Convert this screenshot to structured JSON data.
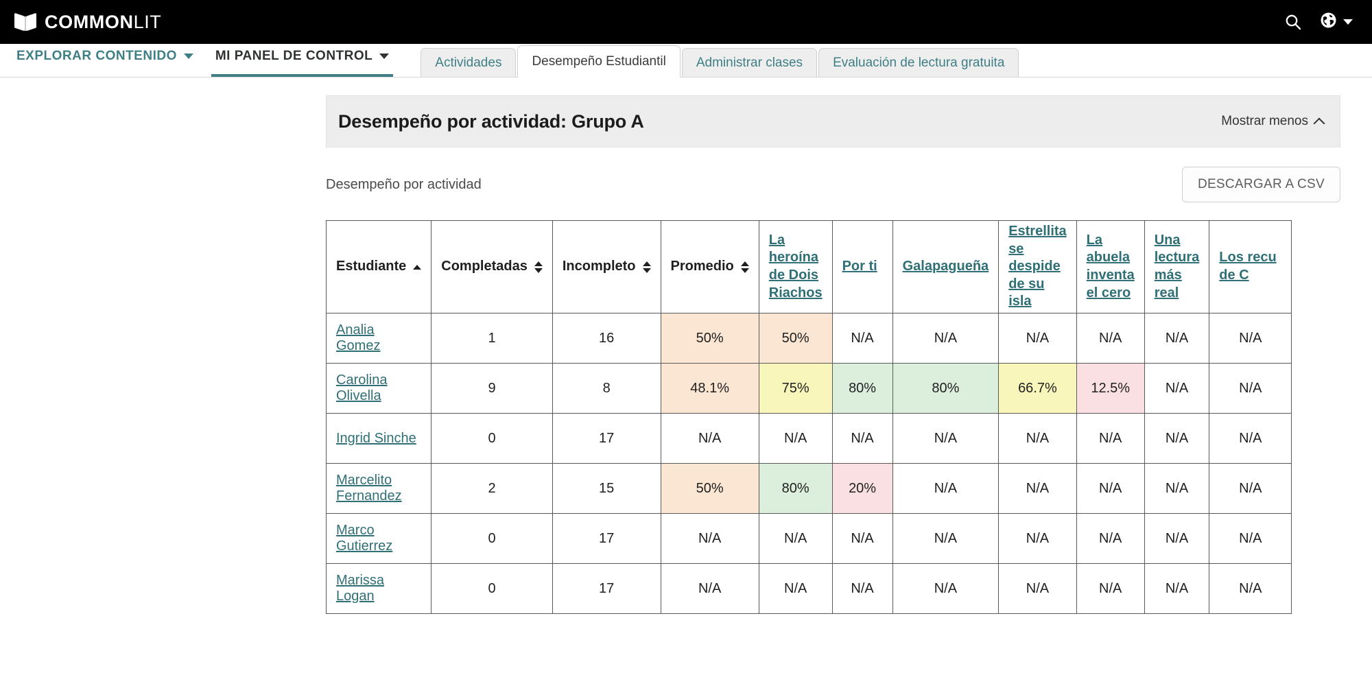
{
  "brand": {
    "name_bold": "COMMON",
    "name_light": "LIT",
    "logo_icon": "open-book-icon"
  },
  "topbar": {
    "search_icon": "search-icon",
    "language_icon": "globe-icon",
    "language_caret": "chevron-down-icon"
  },
  "nav": {
    "primary": [
      {
        "label": "EXPLORAR CONTENIDO",
        "active": false
      },
      {
        "label": "MI PANEL DE CONTROL",
        "active": true
      }
    ],
    "tabs": [
      {
        "label": "Actividades",
        "active": false
      },
      {
        "label": "Desempeño Estudiantil",
        "active": true
      },
      {
        "label": "Administrar clases",
        "active": false
      },
      {
        "label": "Evaluación de lectura gratuita",
        "active": false
      }
    ]
  },
  "panel": {
    "title": "Desempeño por actividad: Grupo A",
    "toggle_label": "Mostrar menos",
    "toggle_icon": "chevron-up-icon",
    "subtitle": "Desempeño por actividad",
    "download_button": "DESCARGAR A CSV"
  },
  "colors": {
    "brand_teal": "#3e7f85",
    "link_teal": "#2f6f76",
    "cell_orange": "#fae6d2",
    "cell_yellow": "#f8f6bb",
    "cell_green": "#dcefdc",
    "cell_pink": "#fadfe3",
    "topbar_black": "#000000",
    "panel_header_gray": "#ededed"
  },
  "table": {
    "headers": [
      {
        "label": "Estudiante",
        "sort": "asc",
        "link": false
      },
      {
        "label": "Completadas",
        "sort": "both",
        "link": false
      },
      {
        "label": "Incompleto",
        "sort": "both",
        "link": false
      },
      {
        "label": "Promedio",
        "sort": "both",
        "link": false
      },
      {
        "label": "La heroína de Dois Riachos",
        "sort": "none",
        "link": true
      },
      {
        "label": "Por ti",
        "sort": "none",
        "link": true
      },
      {
        "label": "Galapagueña",
        "sort": "none",
        "link": true
      },
      {
        "label": "Estrellita se despide de su isla",
        "sort": "none",
        "link": true
      },
      {
        "label": "La abuela inventa el cero",
        "sort": "none",
        "link": true
      },
      {
        "label": "Una lectura más real",
        "sort": "none",
        "link": true
      },
      {
        "label": "Los recu de C",
        "sort": "none",
        "link": true,
        "truncated": true
      }
    ],
    "rows": [
      {
        "student": "Analia Gomez",
        "completadas": "1",
        "incompleto": "16",
        "promedio": {
          "value": "50%",
          "color": "orange"
        },
        "activities": [
          {
            "value": "50%",
            "color": "orange"
          },
          {
            "value": "N/A",
            "color": "none"
          },
          {
            "value": "N/A",
            "color": "none"
          },
          {
            "value": "N/A",
            "color": "none"
          },
          {
            "value": "N/A",
            "color": "none"
          },
          {
            "value": "N/A",
            "color": "none"
          },
          {
            "value": "N/A",
            "color": "none"
          }
        ]
      },
      {
        "student": "Carolina Olivella",
        "completadas": "9",
        "incompleto": "8",
        "promedio": {
          "value": "48.1%",
          "color": "orange"
        },
        "activities": [
          {
            "value": "75%",
            "color": "yellow"
          },
          {
            "value": "80%",
            "color": "green"
          },
          {
            "value": "80%",
            "color": "green"
          },
          {
            "value": "66.7%",
            "color": "yellow"
          },
          {
            "value": "12.5%",
            "color": "pink"
          },
          {
            "value": "N/A",
            "color": "none"
          },
          {
            "value": "N/A",
            "color": "none"
          }
        ]
      },
      {
        "student": "Ingrid Sinche",
        "completadas": "0",
        "incompleto": "17",
        "promedio": {
          "value": "N/A",
          "color": "none"
        },
        "activities": [
          {
            "value": "N/A",
            "color": "none"
          },
          {
            "value": "N/A",
            "color": "none"
          },
          {
            "value": "N/A",
            "color": "none"
          },
          {
            "value": "N/A",
            "color": "none"
          },
          {
            "value": "N/A",
            "color": "none"
          },
          {
            "value": "N/A",
            "color": "none"
          },
          {
            "value": "N/A",
            "color": "none"
          }
        ]
      },
      {
        "student": "Marcelito Fernandez",
        "completadas": "2",
        "incompleto": "15",
        "promedio": {
          "value": "50%",
          "color": "orange"
        },
        "activities": [
          {
            "value": "80%",
            "color": "green"
          },
          {
            "value": "20%",
            "color": "pink"
          },
          {
            "value": "N/A",
            "color": "none"
          },
          {
            "value": "N/A",
            "color": "none"
          },
          {
            "value": "N/A",
            "color": "none"
          },
          {
            "value": "N/A",
            "color": "none"
          },
          {
            "value": "N/A",
            "color": "none"
          }
        ]
      },
      {
        "student": "Marco Gutierrez",
        "completadas": "0",
        "incompleto": "17",
        "promedio": {
          "value": "N/A",
          "color": "none"
        },
        "activities": [
          {
            "value": "N/A",
            "color": "none"
          },
          {
            "value": "N/A",
            "color": "none"
          },
          {
            "value": "N/A",
            "color": "none"
          },
          {
            "value": "N/A",
            "color": "none"
          },
          {
            "value": "N/A",
            "color": "none"
          },
          {
            "value": "N/A",
            "color": "none"
          },
          {
            "value": "N/A",
            "color": "none"
          }
        ]
      },
      {
        "student": "Marissa Logan",
        "completadas": "0",
        "incompleto": "17",
        "promedio": {
          "value": "N/A",
          "color": "none"
        },
        "activities": [
          {
            "value": "N/A",
            "color": "none"
          },
          {
            "value": "N/A",
            "color": "none"
          },
          {
            "value": "N/A",
            "color": "none"
          },
          {
            "value": "N/A",
            "color": "none"
          },
          {
            "value": "N/A",
            "color": "none"
          },
          {
            "value": "N/A",
            "color": "none"
          },
          {
            "value": "N/A",
            "color": "none"
          }
        ]
      }
    ]
  }
}
